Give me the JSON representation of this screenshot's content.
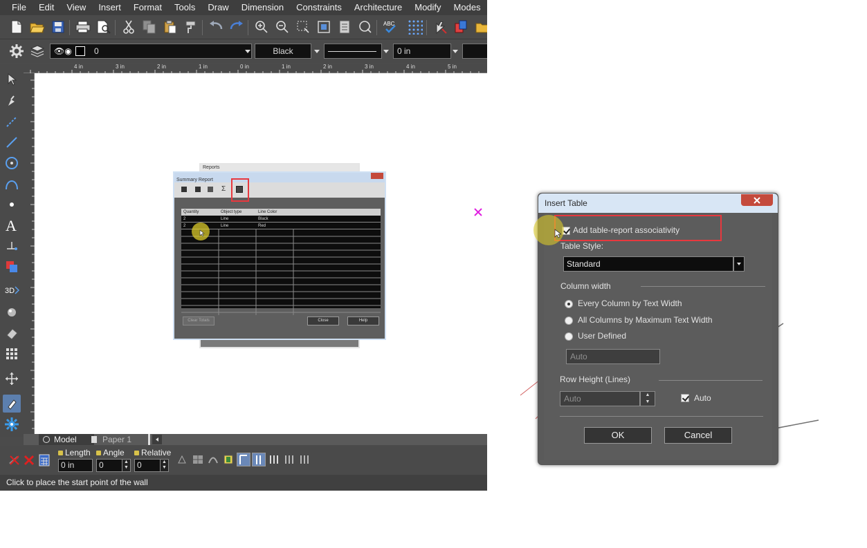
{
  "menubar": {
    "items": [
      "File",
      "Edit",
      "View",
      "Insert",
      "Format",
      "Tools",
      "Draw",
      "Dimension",
      "Constraints",
      "Architecture",
      "Modify",
      "Modes"
    ]
  },
  "toolbar2": {
    "layer_value": "0",
    "color_value": "Black",
    "thickness_value": "0 in"
  },
  "ruler": {
    "top_labels": [
      "4 in",
      "3 in",
      "2 in",
      "1 in",
      "0 in",
      "1 in",
      "2 in",
      "3 in",
      "4 in",
      "5 in"
    ]
  },
  "summary_report": {
    "back_title": "Reports",
    "title": "Summary Report",
    "columns": [
      "Quantity",
      "Object type",
      "Line Color"
    ],
    "rows": [
      [
        "2",
        "Line",
        "Black"
      ],
      [
        "2",
        "Line",
        "Red"
      ]
    ],
    "clear_totals_label": "Clear Totals",
    "close_label": "Close",
    "help_label": "Help"
  },
  "tabs": {
    "model_label": "Model",
    "paper_label": "Paper 1"
  },
  "inspection": {
    "length_label": "Length",
    "length_value": "0 in",
    "angle_label": "Angle",
    "angle_value": "0",
    "relative_label": "Relative",
    "relative_value": "0"
  },
  "status": {
    "message": "Click to place the start point of the wall"
  },
  "insert_table": {
    "title": "Insert Table",
    "associativity_label": "Add table-report associativity",
    "table_style_label": "Table Style:",
    "table_style_value": "Standard",
    "column_width_label": "Column width",
    "option_every_column": "Every Column by Text Width",
    "option_all_columns": "All Columns by Maximum Text Width",
    "option_user_defined": "User Defined",
    "user_defined_placeholder": "Auto",
    "row_height_label": "Row Height (Lines)",
    "row_height_value": "Auto",
    "auto_label": "Auto",
    "ok_label": "OK",
    "cancel_label": "Cancel"
  },
  "colors": {
    "accent_red": "#e8383e",
    "cursor_highlight": "#d8c82a",
    "marker_magenta": "#e020e0"
  }
}
